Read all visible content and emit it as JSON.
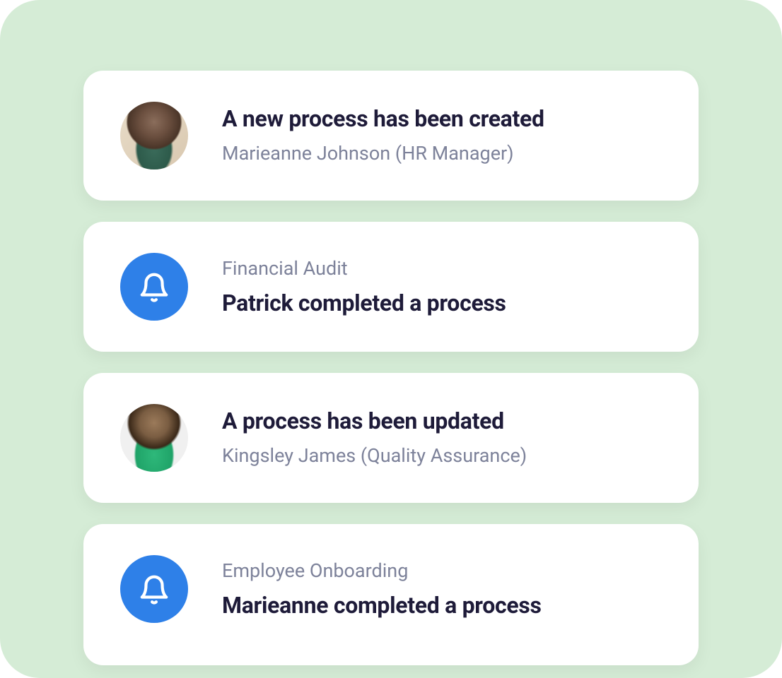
{
  "notifications": [
    {
      "type": "avatar",
      "avatar_style": "person-1",
      "title": "A new process has been created",
      "subtitle": "Marieanne Johnson (HR Manager)"
    },
    {
      "type": "bell",
      "overline": "Financial Audit",
      "title": "Patrick completed a process"
    },
    {
      "type": "avatar",
      "avatar_style": "person-2",
      "title": "A process has been updated",
      "subtitle": "Kingsley James (Quality Assurance)"
    },
    {
      "type": "bell",
      "overline": "Employee Onboarding",
      "title": "Marieanne completed a process"
    }
  ],
  "colors": {
    "background": "#d5ecd6",
    "card": "#ffffff",
    "bell_bg": "#2e80e8",
    "title": "#1e1b39",
    "subtitle": "#7d829a"
  }
}
